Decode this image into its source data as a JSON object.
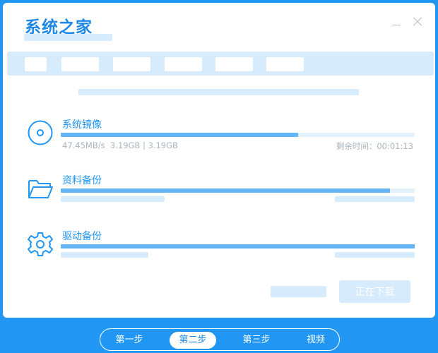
{
  "app": {
    "title": "系统之家"
  },
  "window_controls": {
    "minimize": "minimize-icon",
    "close": "close-icon"
  },
  "tasks": [
    {
      "name": "系统镜像",
      "icon": "disc-icon",
      "progress": 0.67,
      "stats": "47.45MB/s  3.19GB | 3.19GB",
      "remaining": "剩余时间：00:01:13"
    },
    {
      "name": "资料备份",
      "icon": "folder-icon",
      "progress": 0.93
    },
    {
      "name": "驱动备份",
      "icon": "gear-icon",
      "progress": 1.0
    }
  ],
  "footer": {
    "download_label": "正在下载"
  },
  "steps": [
    {
      "label": "第一步"
    },
    {
      "label": "第二步",
      "active": true
    },
    {
      "label": "第三步"
    },
    {
      "label": "视频"
    }
  ],
  "colors": {
    "accent": "#2196f3",
    "title": "#1e88e5",
    "progress_fill": "#64b5f6",
    "placeholder": "#d6ebfb"
  }
}
